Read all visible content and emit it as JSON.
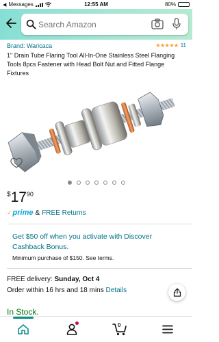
{
  "status_bar": {
    "carrier": "Messages",
    "time": "12:55 AM",
    "battery": "80%",
    "battery_level": 0.8
  },
  "search": {
    "placeholder": "Search Amazon"
  },
  "product": {
    "brand": "Brand: Waricaca",
    "stars": "★★★★★",
    "rating_count": "11",
    "title": "1\" Drain Tube Flaring Tool All-In-One Stainless Steel Flanging Tools 8pcs Fastener with Head Bolt Nut and Fitted Flange Fixtures",
    "image_count": 7,
    "active_image_index": 0,
    "price_symbol": "$",
    "price_whole": "17",
    "price_fraction": "90",
    "prime_label": "prime",
    "prime_amp": "&",
    "free_returns": "FREE Returns"
  },
  "promo": {
    "text": "Get $50 off when you activate with Discover Cashback Bonus.",
    "subtext": "Minimum purchase of $150. See terms."
  },
  "delivery": {
    "prefix": "FREE delivery: ",
    "date": "Sunday, Oct 4",
    "order_prefix": "Order within 16 hrs and 18 mins ",
    "details_link": "Details"
  },
  "stock": {
    "status": "In Stock."
  },
  "bottom_nav": {
    "cart_count": "0"
  },
  "colors": {
    "link": "#007185",
    "star": "#f79d2b",
    "prime_blue": "#0aa3d6",
    "in_stock": "#007600",
    "header_start": "#86dfd4",
    "header_end": "#b6ead2"
  }
}
